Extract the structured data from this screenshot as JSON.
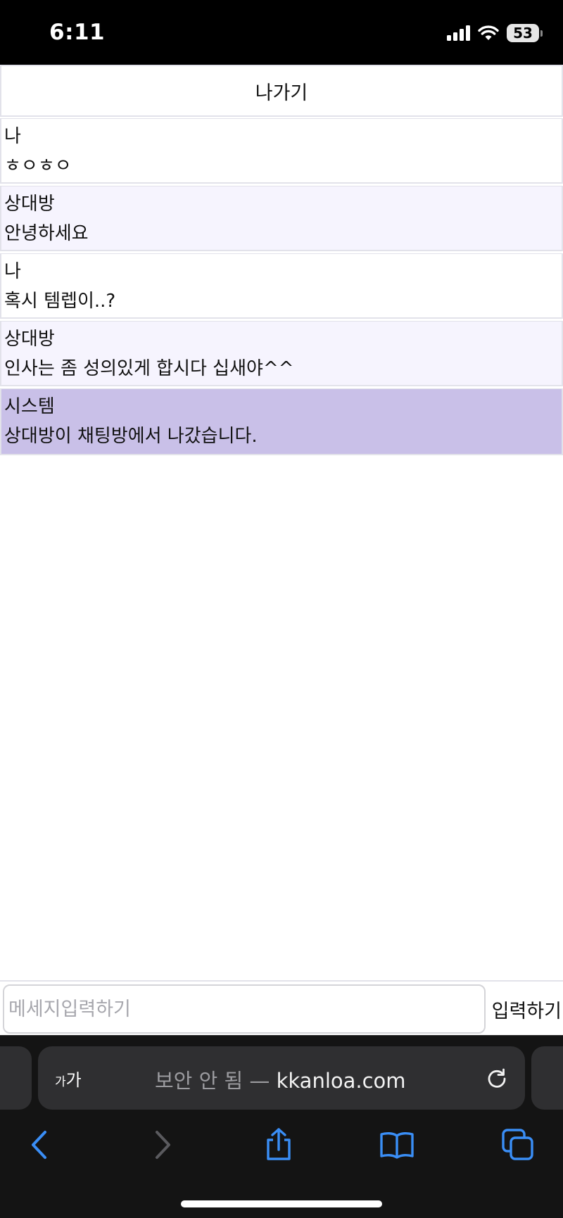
{
  "status_bar": {
    "time": "6:11",
    "battery": "53",
    "icons": [
      "signal-icon",
      "wifi-icon",
      "battery-icon"
    ]
  },
  "chat": {
    "exit_label": "나가기",
    "messages": [
      {
        "sender": "나",
        "text": "ㅎㅇㅎㅇ",
        "type": "me"
      },
      {
        "sender": "상대방",
        "text": "안녕하세요",
        "type": "other"
      },
      {
        "sender": "나",
        "text": "혹시 템렙이..?",
        "type": "me"
      },
      {
        "sender": "상대방",
        "text": "인사는 좀 성의있게 합시다 십새야^^",
        "type": "other"
      },
      {
        "sender": "시스템",
        "text": "상대방이 채팅방에서 나갔습니다.",
        "type": "system"
      }
    ],
    "input_placeholder": "메세지입력하기",
    "input_value": "",
    "send_label": "입력하기"
  },
  "browser": {
    "aa_small": "가",
    "aa_large": "가",
    "url_prefix": "보안 안 됨 — ",
    "url_domain": "kkanloa.com",
    "icons": [
      "reload-icon",
      "back-icon",
      "forward-icon",
      "share-icon",
      "bookmarks-icon",
      "tabs-icon"
    ]
  },
  "colors": {
    "other_bg": "#f6f4fe",
    "system_bg": "#c9c0e8",
    "border": "#e2e2ea",
    "ios_blue": "#3a8ef6"
  }
}
